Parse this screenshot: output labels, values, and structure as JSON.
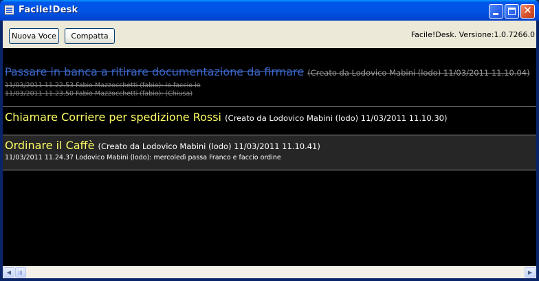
{
  "window": {
    "title": "Facile!Desk",
    "icons": {
      "app": "app-icon",
      "minimize": "minimize-icon",
      "maximize": "maximize-icon",
      "close": "close-icon"
    },
    "close_glyph": "✕"
  },
  "toolbar": {
    "new_item_label": "Nuova Voce",
    "compact_label": "Compatta",
    "version_text": "Facile!Desk. Versione:1.0.7266.0"
  },
  "items": [
    {
      "title": "Passare in banca a ritirare documentazione da firmare",
      "meta": "(Creato da Lodovico Mabini (lodo) 11/03/2011 11.10.04)",
      "status": "closed",
      "notes": [
        "11/03/2011 11.22.53 Fabio Mazzocchetti (fabio): lo faccio io",
        "11/03/2011 11.23.50 Fabio Mazzocchetti (fabio): (Chiusa)"
      ]
    },
    {
      "title": "Chiamare Corriere per spedizione Rossi",
      "meta": "(Creato da Lodovico Mabini (lodo) 11/03/2011 11.10.30)",
      "status": "open",
      "notes": []
    },
    {
      "title": "Ordinare il Caffè",
      "meta": "(Creato da Lodovico Mabini (lodo) 11/03/2011 11.10.41)",
      "status": "open",
      "notes": [
        "11/03/2011 11.24.37 Lodovico Mabini (lodo): mercoledì passa Franco e faccio ordine"
      ]
    }
  ],
  "scrollbar": {
    "left_arrow": "◀",
    "right_arrow": "▶"
  },
  "colors": {
    "list_background": "#000000",
    "title_open": "#ffff66",
    "title_closed": "#3a66c8",
    "meta_closed": "#9a9a9a",
    "selected_row": "#262626",
    "toolbar": "#ece9d8",
    "titlebar": "#0055e5"
  }
}
